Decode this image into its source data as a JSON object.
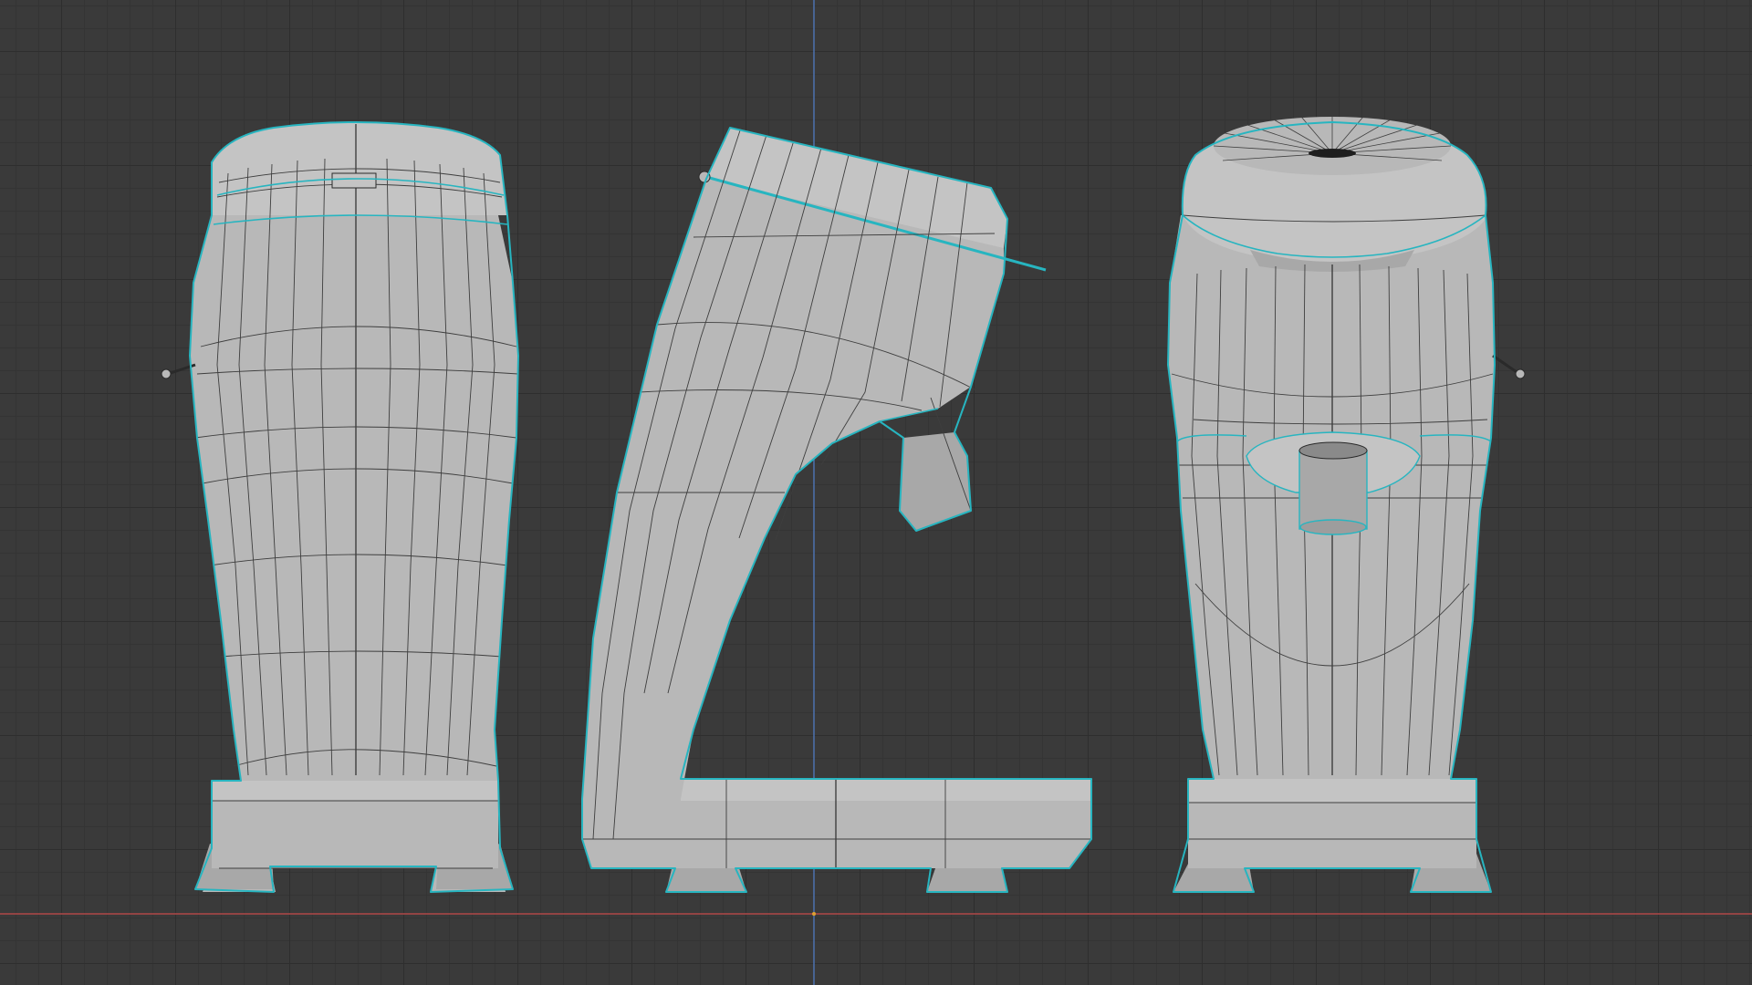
{
  "viewport": {
    "background_color": "#3a3a3a",
    "grid_color": "#2e2e2e",
    "axis_x_color": "#b04848",
    "axis_z_color": "#4f77b8",
    "mesh_fill_color": "#b8b8b8",
    "wire_color": "#3e3e3e",
    "selection_outline_color": "#27b5c0",
    "view": "orthographic",
    "grid": true
  },
  "objects": [
    {
      "id": "front",
      "view": "front"
    },
    {
      "id": "side",
      "view": "side"
    },
    {
      "id": "back",
      "view": "back"
    }
  ]
}
